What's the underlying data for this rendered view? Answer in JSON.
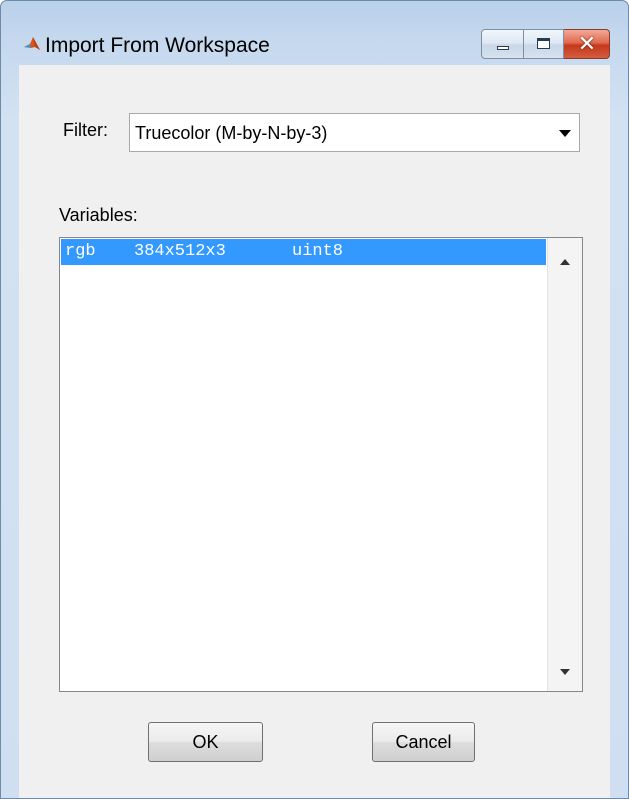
{
  "window": {
    "title": "Import From Workspace",
    "icon": "matlab-logo-icon",
    "controls": [
      "minimize-icon",
      "maximize-icon",
      "close-icon"
    ],
    "close_glyph": "✕"
  },
  "filter": {
    "label": "Filter:",
    "selected": "Truecolor (M-by-N-by-3)"
  },
  "variables": {
    "label": "Variables:",
    "rows": [
      {
        "name": "rgb",
        "size": "384x512x3",
        "class": "uint8",
        "selected": true
      }
    ]
  },
  "buttons": {
    "ok": "OK",
    "cancel": "Cancel"
  },
  "colors": {
    "selection": "#3399ff",
    "selection_text": "#ffffff",
    "close_button": "#c6391a"
  }
}
